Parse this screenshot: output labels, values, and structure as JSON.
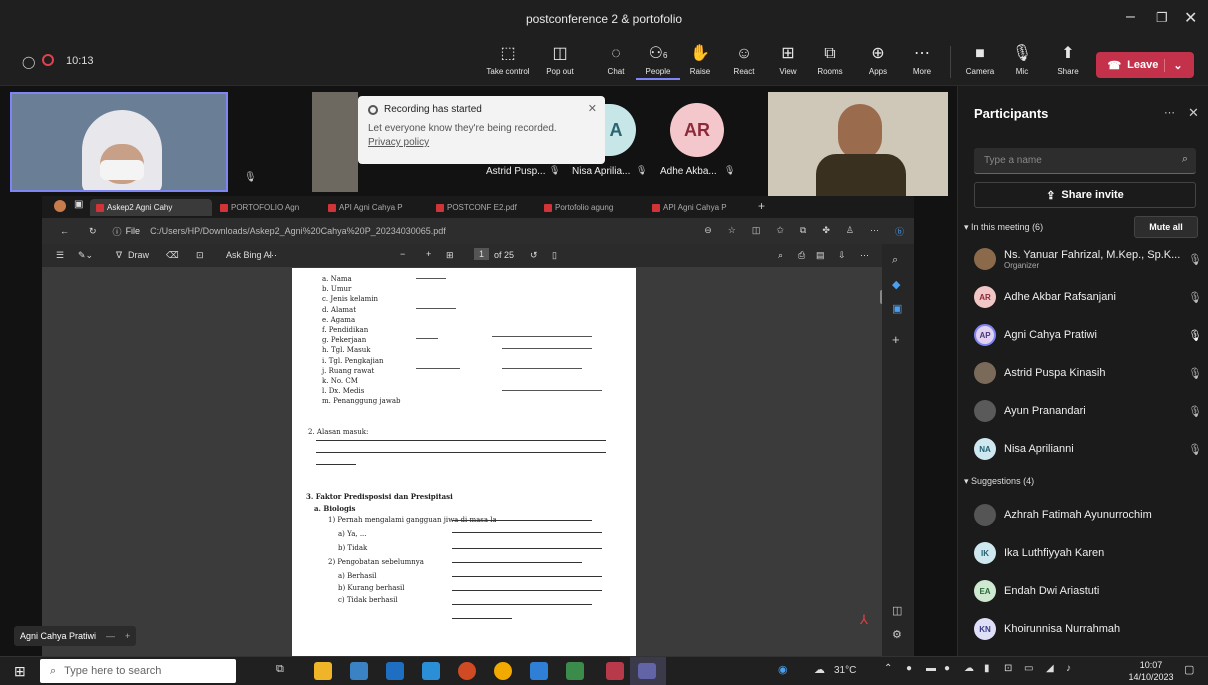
{
  "window": {
    "title": "postconference 2 & portofolio"
  },
  "meeting": {
    "timer": "10:13"
  },
  "toolbar": {
    "buttons": [
      {
        "label": "Take control",
        "icon": "take-control-icon"
      },
      {
        "label": "Pop out",
        "icon": "pop-out-icon"
      },
      {
        "label": "Chat",
        "icon": "chat-icon"
      },
      {
        "label": "People",
        "icon": "people-icon",
        "count": "6"
      },
      {
        "label": "Raise",
        "icon": "raise-hand-icon"
      },
      {
        "label": "React",
        "icon": "react-icon"
      },
      {
        "label": "View",
        "icon": "view-icon"
      },
      {
        "label": "Rooms",
        "icon": "rooms-icon"
      },
      {
        "label": "Apps",
        "icon": "apps-icon"
      },
      {
        "label": "More",
        "icon": "more-icon"
      },
      {
        "label": "Camera",
        "icon": "camera-icon"
      },
      {
        "label": "Mic",
        "icon": "mic-off-icon"
      },
      {
        "label": "Share",
        "icon": "share-icon"
      }
    ],
    "leave_label": "Leave"
  },
  "notification": {
    "title": "Recording has started",
    "body": "Let everyone know they're being recorded.",
    "link": "Privacy policy"
  },
  "tiles": [
    {
      "name": "Astrid Pusp..."
    },
    {
      "name": "Nisa Aprilia..."
    },
    {
      "name": "Adhe Akba..."
    }
  ],
  "avatars": {
    "a": "A",
    "ar": "AR"
  },
  "self_label": "Agni Cahya Pratiwi",
  "browser": {
    "tabs": [
      "Askep2 Agni Cahy",
      "PORTOFOLIO Agn",
      "API Agni Cahya P",
      "POSTCONF E2.pdf",
      "Portofolio agung",
      "API Agni Cahya P"
    ],
    "address_prefix": "File",
    "address": "C:/Users/HP/Downloads/Askep2_Agni%20Cahya%20P_20234030065.pdf",
    "pdf_draw": "Draw",
    "pdf_ask": "Ask Bing AI",
    "page_num": "1",
    "page_of": "of 25"
  },
  "document": {
    "fields": [
      "a. Nama",
      "b. Umur",
      "c. Jenis kelamin",
      "d. Alamat",
      "e. Agama",
      "f. Pendidikan",
      "g. Pekerjaan",
      "h. Tgl. Masuk",
      "i. Tgl. Pengkajian",
      "j. Ruang rawat",
      "k. No. CM",
      "l. Dx. Medis",
      "m. Penanggung jawab"
    ],
    "section2": "2. Alasan masuk:",
    "section3": "3. Faktor Predisposisi dan Presipitasi",
    "sub_a": "a. Biologis",
    "q1": "1) Pernah mengalami gangguan jiwa di masa lalu? Kapan? Apa yang dilakukan?",
    "opt_ya": "a) Ya, ...",
    "opt_tidak": "b) Tidak",
    "q2": "2) Pengobatan sebelumnya",
    "opt2": [
      "a) Berhasil",
      "b) Kurang berhasil",
      "c) Tidak berhasil"
    ]
  },
  "panel": {
    "title": "Participants",
    "search_placeholder": "Type a name",
    "share_invite": "Share invite",
    "in_meeting": "In this meeting (6)",
    "mute_all": "Mute all",
    "participants": [
      {
        "name": "Ns. Yanuar Fahrizal, M.Kep., Sp.K...",
        "role": "Organizer",
        "initials": "",
        "color": "#8a6a4a"
      },
      {
        "name": "Adhe Akbar Rafsanjani",
        "initials": "AR",
        "color": "#f0c6c6"
      },
      {
        "name": "Agni Cahya Pratiwi",
        "initials": "AP",
        "color": "#e0d2f0"
      },
      {
        "name": "Astrid Puspa Kinasih",
        "initials": "",
        "color": "#7a6a5a"
      },
      {
        "name": "Ayun Pranandari",
        "initials": "",
        "color": "#5a5a5a"
      },
      {
        "name": "Nisa Aprilianni",
        "initials": "NA",
        "color": "#cfe8f0"
      }
    ],
    "suggestions": "Suggestions (4)",
    "suggested": [
      {
        "name": "Azhrah Fatimah Ayunurrochim",
        "initials": "",
        "color": "#555"
      },
      {
        "name": "Ika Luthfiyyah Karen",
        "initials": "IK",
        "color": "#cfe8f0"
      },
      {
        "name": "Endah Dwi Ariastuti",
        "initials": "EA",
        "color": "#cfe8d0"
      },
      {
        "name": "Khoirunnisa Nurrahmah",
        "initials": "KN",
        "color": "#dfe0f8"
      }
    ]
  },
  "taskbar": {
    "search_placeholder": "Type here to search",
    "weather": "31°C",
    "time": "10:07",
    "date": "14/10/2023"
  }
}
